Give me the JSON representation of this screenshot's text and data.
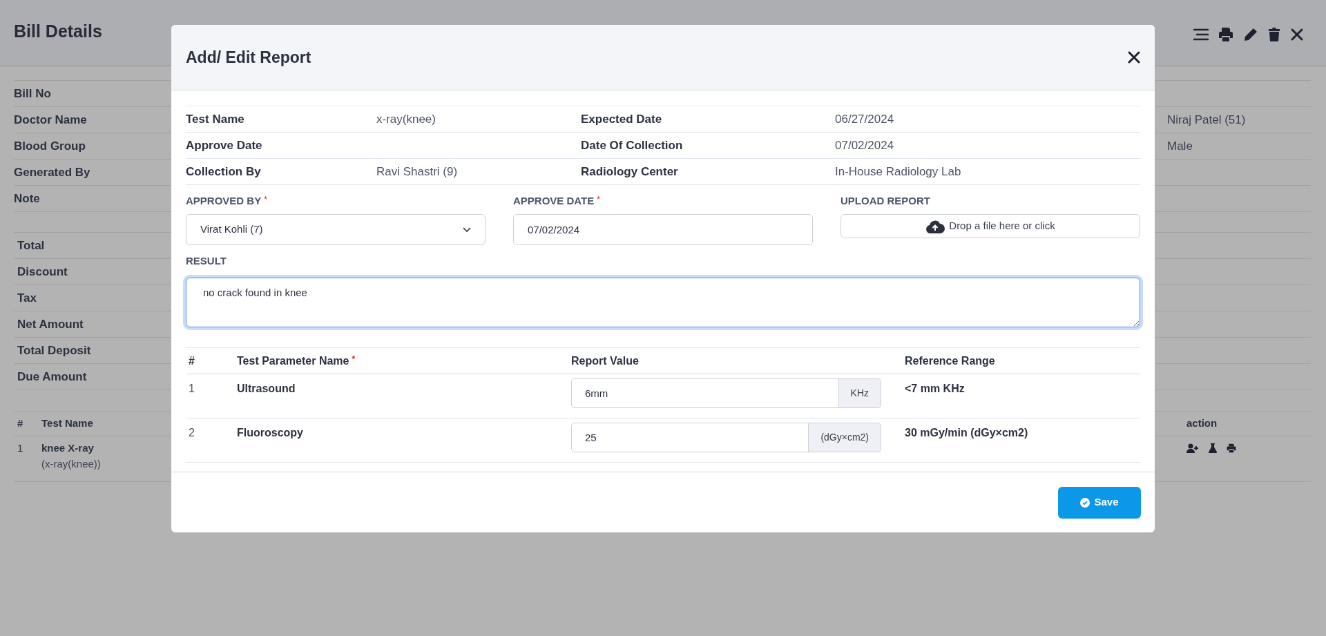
{
  "page": {
    "title": "Bill Details",
    "bill_fields": [
      {
        "label": "Bill No"
      },
      {
        "label": "Doctor Name",
        "right_value": "Niraj Patel (51)"
      },
      {
        "label": "Blood Group",
        "right_value": "Male"
      },
      {
        "label": "Generated By"
      },
      {
        "label": "Note"
      }
    ],
    "totals": [
      "Total",
      "Discount",
      "Tax",
      "Net Amount",
      "Total Deposit",
      "Due Amount"
    ],
    "tests_table": {
      "columns": [
        "#",
        "Test Name",
        "action"
      ],
      "rows": [
        {
          "number": "1",
          "name": "knee X-ray",
          "code": "(x-ray(knee))"
        }
      ]
    }
  },
  "modal": {
    "title": "Add/ Edit Report",
    "info_rows": [
      {
        "label": "Test Name",
        "value": "x-ray(knee)",
        "label_2": "Expected Date",
        "value_2": "06/27/2024"
      },
      {
        "label": "Approve Date",
        "label_2": "Date Of Collection",
        "value_2": "07/02/2024"
      },
      {
        "label": "Collection By",
        "value": "Ravi Shastri (9)",
        "label_2": "Radiology Center",
        "value_2": "In-House Radiology Lab"
      }
    ],
    "approved_by": {
      "label": "APPROVED BY",
      "required_mark": "*",
      "value": "Virat Kohli (7)"
    },
    "approve_date": {
      "label": "APPROVE DATE",
      "required_mark": "*",
      "value": "07/02/2024"
    },
    "upload": {
      "label": "UPLOAD REPORT",
      "button": "Drop a file here or click"
    },
    "result": {
      "label": "RESULT",
      "value": "no crack found in knee"
    },
    "parameters": {
      "columns": [
        {
          "label": "#"
        },
        {
          "label": "Test Parameter Name",
          "required_mark": "*"
        },
        {
          "label": "Report Value"
        },
        {
          "label": "Reference Range"
        }
      ],
      "rows": [
        {
          "number": "1",
          "name": "Ultrasound",
          "value": "6mm",
          "unit": "KHz",
          "reference": "<7 mm KHz"
        },
        {
          "number": "2",
          "name": "Fluoroscopy",
          "value": "25",
          "unit": "(dGy×cm2)",
          "reference": "30 mGy/min (dGy×cm2)"
        }
      ]
    },
    "save_button": "Save"
  }
}
